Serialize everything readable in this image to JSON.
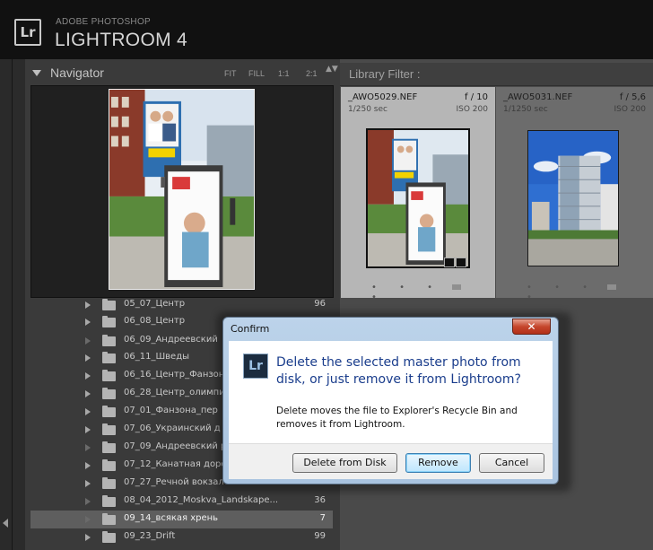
{
  "app": {
    "logo": "Lr",
    "brand_small": "ADOBE PHOTOSHOP",
    "brand_large": "LIGHTROOM 4"
  },
  "navigator": {
    "title": "Navigator",
    "zoom_options": [
      "FIT",
      "FILL",
      "1:1",
      "2:1"
    ],
    "arrows": "▲▼"
  },
  "library_filter": {
    "label": "Library Filter :"
  },
  "folders": [
    {
      "label": "05_07_Центр",
      "count": "96",
      "expandable": true
    },
    {
      "label": "06_08_Центр",
      "count": "",
      "expandable": true
    },
    {
      "label": "06_09_Андреевский",
      "count": "",
      "expandable": false
    },
    {
      "label": "06_11_Шведы",
      "count": "",
      "expandable": true
    },
    {
      "label": "06_16_Центр_Фанзон",
      "count": "",
      "expandable": true
    },
    {
      "label": "06_28_Центр_олимпи",
      "count": "",
      "expandable": true
    },
    {
      "label": "07_01_Фанзона_пер",
      "count": "",
      "expandable": true
    },
    {
      "label": "07_06_Украинский д",
      "count": "",
      "expandable": true
    },
    {
      "label": "07_09_Андреевский р",
      "count": "",
      "expandable": false
    },
    {
      "label": "07_12_Канатная доро",
      "count": "",
      "expandable": true
    },
    {
      "label": "07_27_Речной вокзал",
      "count": "",
      "expandable": true
    },
    {
      "label": "08_04_2012_Moskva_Landskape...",
      "count": "36",
      "expandable": false
    },
    {
      "label": "09_14_всякая хрень",
      "count": "7",
      "expandable": false,
      "selected": true
    },
    {
      "label": "09_23_Drift",
      "count": "99",
      "expandable": true
    }
  ],
  "grid": [
    {
      "filename": "_AWO5029.NEF",
      "aperture": "f / 10",
      "shutter": "1/250 sec",
      "iso": "ISO 200",
      "selected": true
    },
    {
      "filename": "_AWO5031.NEF",
      "aperture": "f / 5,6",
      "shutter": "1/1250 sec",
      "iso": "ISO 200",
      "selected": false
    }
  ],
  "grid_dots": "• • • • •",
  "dialog": {
    "title": "Confirm",
    "close_glyph": "✕",
    "icon": "Lr",
    "heading": "Delete the selected master photo from disk, or just remove it from Lightroom?",
    "message": "Delete moves the file to Explorer's Recycle Bin and removes it from Lightroom.",
    "buttons": {
      "delete": "Delete from Disk",
      "remove": "Remove",
      "cancel": "Cancel"
    }
  },
  "colors": {
    "panel_dark": "#3a3a3a",
    "cell_selected": "#b6b6b6",
    "dialog_heading": "#1a3d8c",
    "close_button": "#c5462d"
  }
}
